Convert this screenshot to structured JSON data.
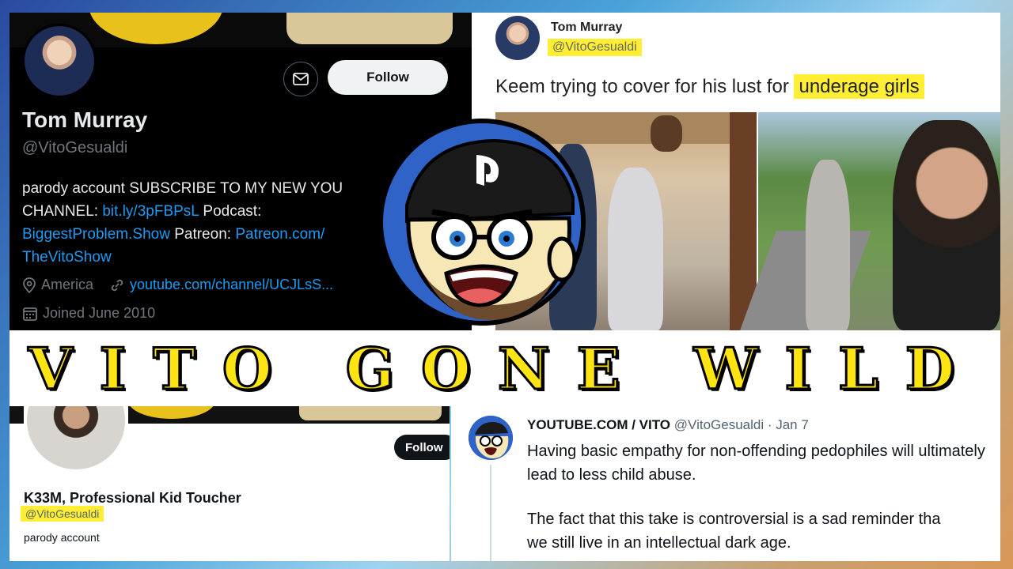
{
  "top_profile": {
    "name": "Tom Murray",
    "handle": "@VitoGesualdi",
    "follow_label": "Follow",
    "bio_line1": "parody account SUBSCRIBE TO MY NEW YOU",
    "bio_line2_prefix": "CHANNEL: ",
    "bio_link1": "bit.ly/3pFBPsL",
    "bio_line2_suffix": " Podcast:",
    "bio_link2": "BiggestProblem.Show",
    "bio_line3_mid": " Patreon: ",
    "bio_link3": "Patreon.com/",
    "bio_link4": "TheVitoShow",
    "location": "America",
    "website": "youtube.com/channel/UCJLsS...",
    "joined": "Joined June 2010"
  },
  "top_tweet": {
    "name": "Tom Murray",
    "handle": "@VitoGesualdi",
    "text_plain": "Keem trying to cover for his lust for ",
    "text_highlight": "underage girls"
  },
  "title": "VITO GONE WILD",
  "bottom_profile": {
    "name": "K33M, Professional Kid Toucher",
    "handle": "@VitoGesualdi",
    "bio": "parody account",
    "follow_label": "Follow"
  },
  "bottom_tweet": {
    "author": "YOUTUBE.COM / VITO",
    "handle_date": "@VitoGesualdi · Jan 7",
    "body1": "Having basic empathy for non-offending pedophiles will ultimately lead to less child abuse.",
    "body2_line1": "The fact that this take is controversial is a sad reminder tha",
    "body2_line2": "we still live in an intellectual dark age."
  },
  "colors": {
    "highlight": "#ffee33",
    "link": "#1d9bf0",
    "title_fill": "#ffe414",
    "twitter_dark": "#000000"
  },
  "icons": [
    "mail-icon",
    "location-icon",
    "link-icon",
    "calendar-icon",
    "playstation-logo-icon"
  ]
}
